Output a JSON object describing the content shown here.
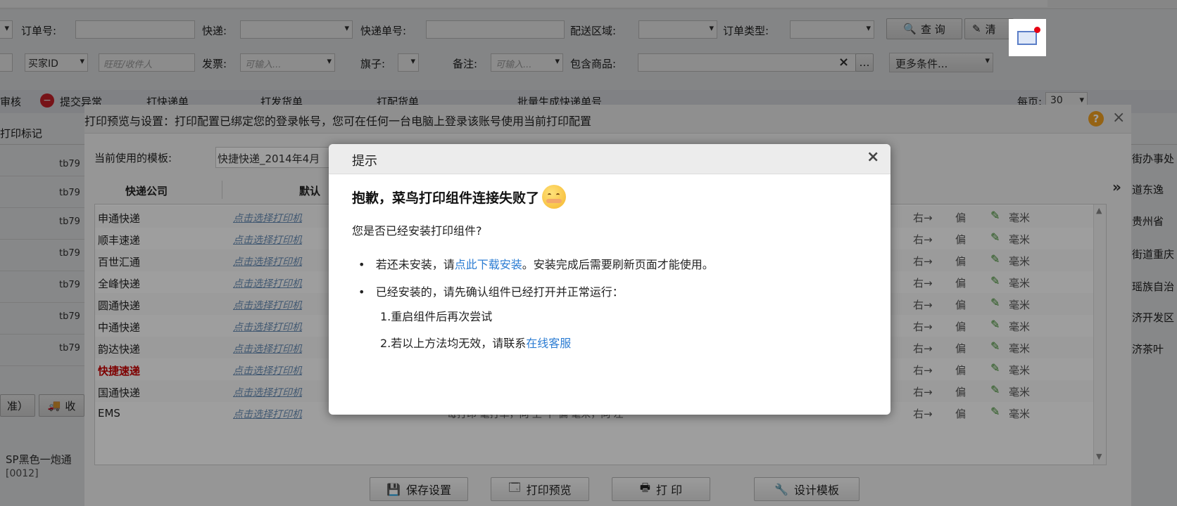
{
  "filters": {
    "order_no_label": "订单号:",
    "express_label": "快递:",
    "express_no_label": "快递单号:",
    "region_label": "配送区域:",
    "order_type_label": "订单类型:",
    "query_button": "查 询",
    "clear_button": "清",
    "buyer_id_select": "买家ID",
    "buyer_placeholder": "旺旺/收件人",
    "invoice_label": "发票:",
    "invoice_placeholder": "可输入...",
    "flag_label": "旗子:",
    "remark_label": "备注:",
    "remark_placeholder": "可输入...",
    "goods_label": "包含商品:",
    "more_conditions": "更多条件..."
  },
  "toolbar": {
    "audit": "审核",
    "submit_exception": "提交异常",
    "print_express": "打快递单",
    "print_delivery": "打发货单",
    "print_picking": "打配货单",
    "batch_generate": "批量生成快递单号",
    "per_page_label": "每页:",
    "per_page_value": "30"
  },
  "grid": {
    "print_mark_header": "打印标记",
    "row_codes": [
      "tb79",
      "tb79",
      "tb79",
      "tb79",
      "tb79",
      "tb79",
      "tb79"
    ],
    "right_texts": [
      "街办事处",
      "道东逸",
      "贵州省",
      "街道重庆",
      "瑶族自治",
      "济开发区",
      "济茶叶"
    ],
    "bottom_tab1": "准）",
    "bottom_tab2": "收",
    "product_text": "SP黑色一炮通",
    "product_code": "[0012]"
  },
  "print_dialog": {
    "title": "打印预览与设置：打印配置已绑定您的登录帐号，您可在任何一台电脑上登录该账号使用当前打印配置",
    "template_label": "当前使用的模板:",
    "template_value": "快捷快递_2014年4月",
    "col_company": "快递公司",
    "col_default": "默认",
    "more_arrow": "»",
    "companies": [
      {
        "name": "申通快递",
        "highlight": false
      },
      {
        "name": "顺丰速递",
        "highlight": false
      },
      {
        "name": "百世汇通",
        "highlight": false
      },
      {
        "name": "全峰快递",
        "highlight": false
      },
      {
        "name": "圆通快递",
        "highlight": false
      },
      {
        "name": "中通快递",
        "highlight": false
      },
      {
        "name": "韵达快递",
        "highlight": false
      },
      {
        "name": "快捷速递",
        "highlight": true
      },
      {
        "name": "国通快递",
        "highlight": false
      },
      {
        "name": "EMS",
        "highlight": false
      }
    ],
    "row_link": "点击选择打印机",
    "right_word": "右→",
    "offset_word": "偏",
    "mm_word": "毫米",
    "last_row_extra": "每打印  毫打单，向  上  下  偏  毫米，向  左",
    "buttons": {
      "save": "保存设置",
      "preview": "打印预览",
      "print": "打 印",
      "design": "设计模板"
    },
    "help_icon": "?",
    "close_icon": "×"
  },
  "alert": {
    "title": "提示",
    "close": "×",
    "heading": "抱歉，菜鸟打印组件连接失败了",
    "question": "您是否已经安装打印组件?",
    "bullet1_prefix": "若还未安装，请",
    "bullet1_link": "点此下载安装",
    "bullet1_suffix": "。安装完成后需要刷新页面才能使用。",
    "bullet2": "已经安装的，请先确认组件已经打开并正常运行：",
    "step1": "1.重启组件后再次尝试",
    "step2_prefix": "2.若以上方法均无效，请联系",
    "step2_link": "在线客服"
  },
  "colors": {
    "link": "#2b7cd3",
    "highlight_company": "#cc0000",
    "notice_dot": "#e60012"
  }
}
